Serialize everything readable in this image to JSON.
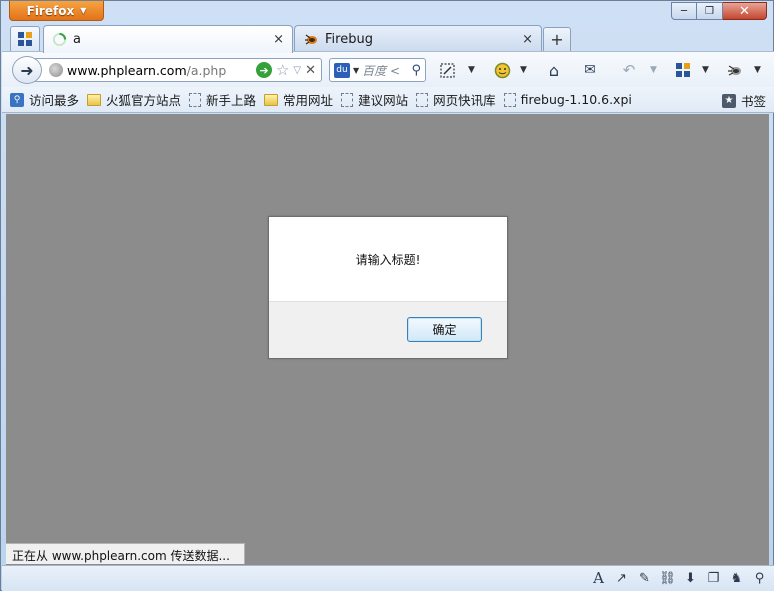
{
  "window": {
    "app_button_label": "Firefox",
    "controls": {
      "minimize": "─",
      "restore": "❐",
      "close": "✕"
    }
  },
  "tabs": [
    {
      "title": "a",
      "icon": "loading-spinner-icon",
      "close": "×",
      "active": true
    },
    {
      "title": "Firebug",
      "icon": "firebug-icon",
      "close": "×",
      "active": false
    }
  ],
  "new_tab_label": "+",
  "navbar": {
    "url_host": "www.phplearn.com",
    "url_path": "/a.php",
    "search_placeholder": "百度 <",
    "search_engine_label": "du"
  },
  "bookmarks": {
    "items": [
      {
        "label": "访问最多",
        "icon": "most-visited-icon"
      },
      {
        "label": "火狐官方站点",
        "icon": "folder-icon"
      },
      {
        "label": "新手上路",
        "icon": "page-icon"
      },
      {
        "label": "常用网址",
        "icon": "folder-icon"
      },
      {
        "label": "建议网站",
        "icon": "page-icon"
      },
      {
        "label": "网页快讯库",
        "icon": "page-icon"
      },
      {
        "label": "firebug-1.10.6.xpi",
        "icon": "page-icon"
      }
    ],
    "bookmarks_menu_label": "书签"
  },
  "dialog": {
    "message": "请输入标题!",
    "ok_label": "确定"
  },
  "status": {
    "text": "正在从 www.phplearn.com 传送数据..."
  },
  "colors": {
    "firefox_orange": "#e2731a",
    "content_overlay": "#8c8c8c",
    "go_green": "#35a13b"
  }
}
